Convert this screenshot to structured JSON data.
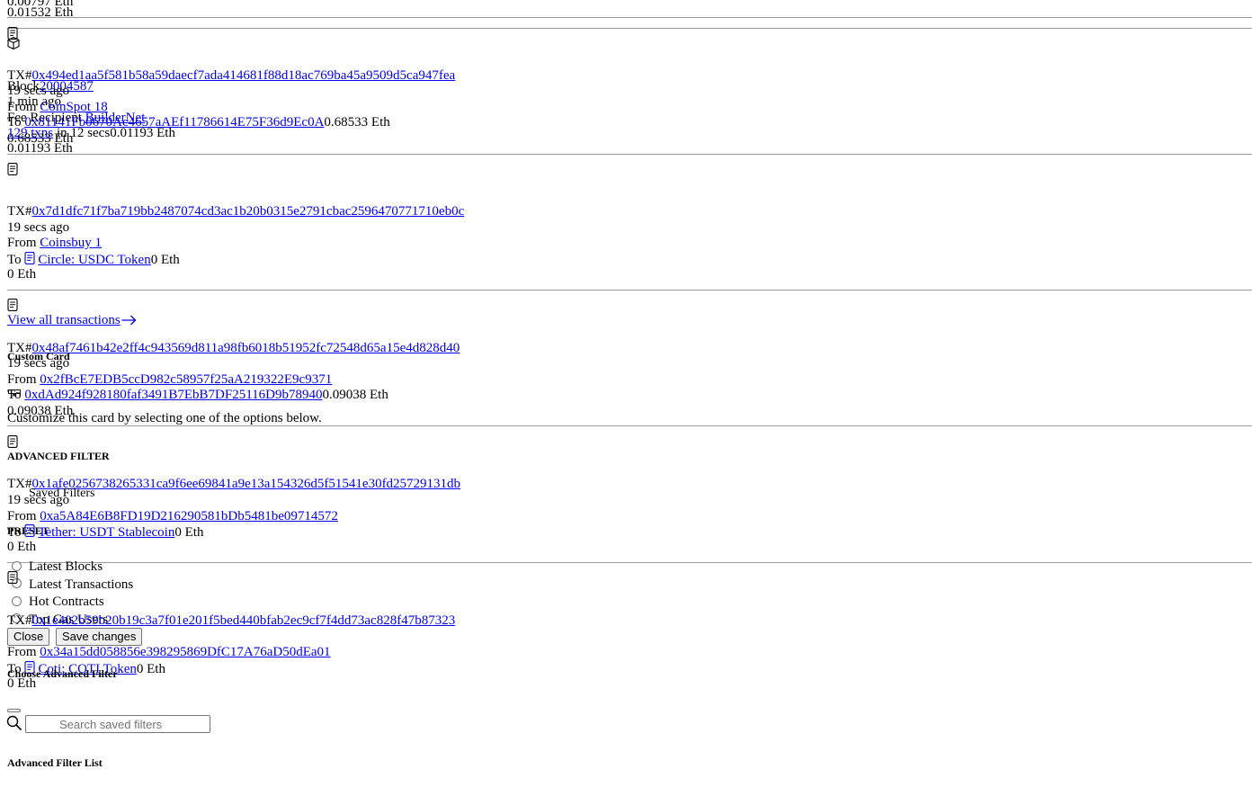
{
  "labels": {
    "tx_prefix": "TX#",
    "from": "From ",
    "to": "To ",
    "fee_recipient": "Fee Recipient "
  },
  "top_remnant": {
    "line1": "0.00797 Eth",
    "line2": "0.01532 Eth"
  },
  "block_item": {
    "label": "Block",
    "number": "20004587",
    "time": "1 min ago",
    "fee_recipient": "BuilderNet",
    "txns": "129 txns",
    "duration": " in 12 secs",
    "reward": "0.01193 Eth",
    "reward2": "0.01193 Eth"
  },
  "transactions": [
    {
      "hash": "0x494ed1aa5f581b58a59daecf7ada414681f88d18ac769ba45a9509d5ca947fea",
      "time": "19 secs ago",
      "from": "CoinSpot 18",
      "to": "0x81141Fb0670Ac4657aAEf11786614E75F36d9Ec0A",
      "amount": "0.68533 Eth",
      "amount2": "0.68533 Eth"
    },
    {
      "hash": "0x7d1dfc71f7ba719bb2487074cd3ac1b20b0315e2791cbac2596470771710eb0c",
      "time": "19 secs ago",
      "from": "Coinsbuy 1",
      "to": "Circle: USDC Token",
      "amount": "0 Eth",
      "amount2": "0 Eth"
    },
    {
      "hash": "0x48af7461b42e2ff4c943569d811a98fb6018b51952fc72548d65a15e4d828d40",
      "time": "19 secs ago",
      "from": "0x2fBcE7EDB5ccD982c58957f25aA219322E9c9371",
      "to": "0xdAd924f928180faf3491B7EbB7DF25116D9b78940",
      "amount": "0.09038 Eth",
      "amount2": "0.09038 Eth"
    },
    {
      "hash": "0x1afe0256738265331ca9f6ee69841a9e13a154326d5f51541e30fd25729131db",
      "time": "19 secs ago",
      "from": "0xa5A84E6B8FD19D216290581bDb5481be09714572",
      "to": "Tether: USDT Stablecoin",
      "amount": "0 Eth",
      "amount2": "0 Eth"
    },
    {
      "hash": "0x1e402b59b20b19c3a7f01e201f5bed440bfab2ec9cf7f4dd73ac828f47b87323",
      "time": "19 secs ago",
      "from": "0x34a15dd058856e398295869DfC17A76aD50dEa01",
      "to": "Coti: COTI Token",
      "amount": "0 Eth",
      "amount2": "0 Eth"
    }
  ],
  "view_all": "View all transactions",
  "custom_card": {
    "title": "Custom Card",
    "description": "Customize this card by selecting one of the options below.",
    "options": [
      "Latest Blocks",
      "Latest Transactions",
      "Hot Contracts",
      "Top Gas Users"
    ],
    "close_label": "Close",
    "save_label": "Save changes"
  },
  "advanced_filter": {
    "title": "ADVANCED FILTER",
    "saved_filters": "Saved Filters",
    "preset": "PRESET",
    "choose_title": "Choose Advanced Filter",
    "search_placeholder": "Search saved filters",
    "list_title": "Advanced Filter List"
  }
}
